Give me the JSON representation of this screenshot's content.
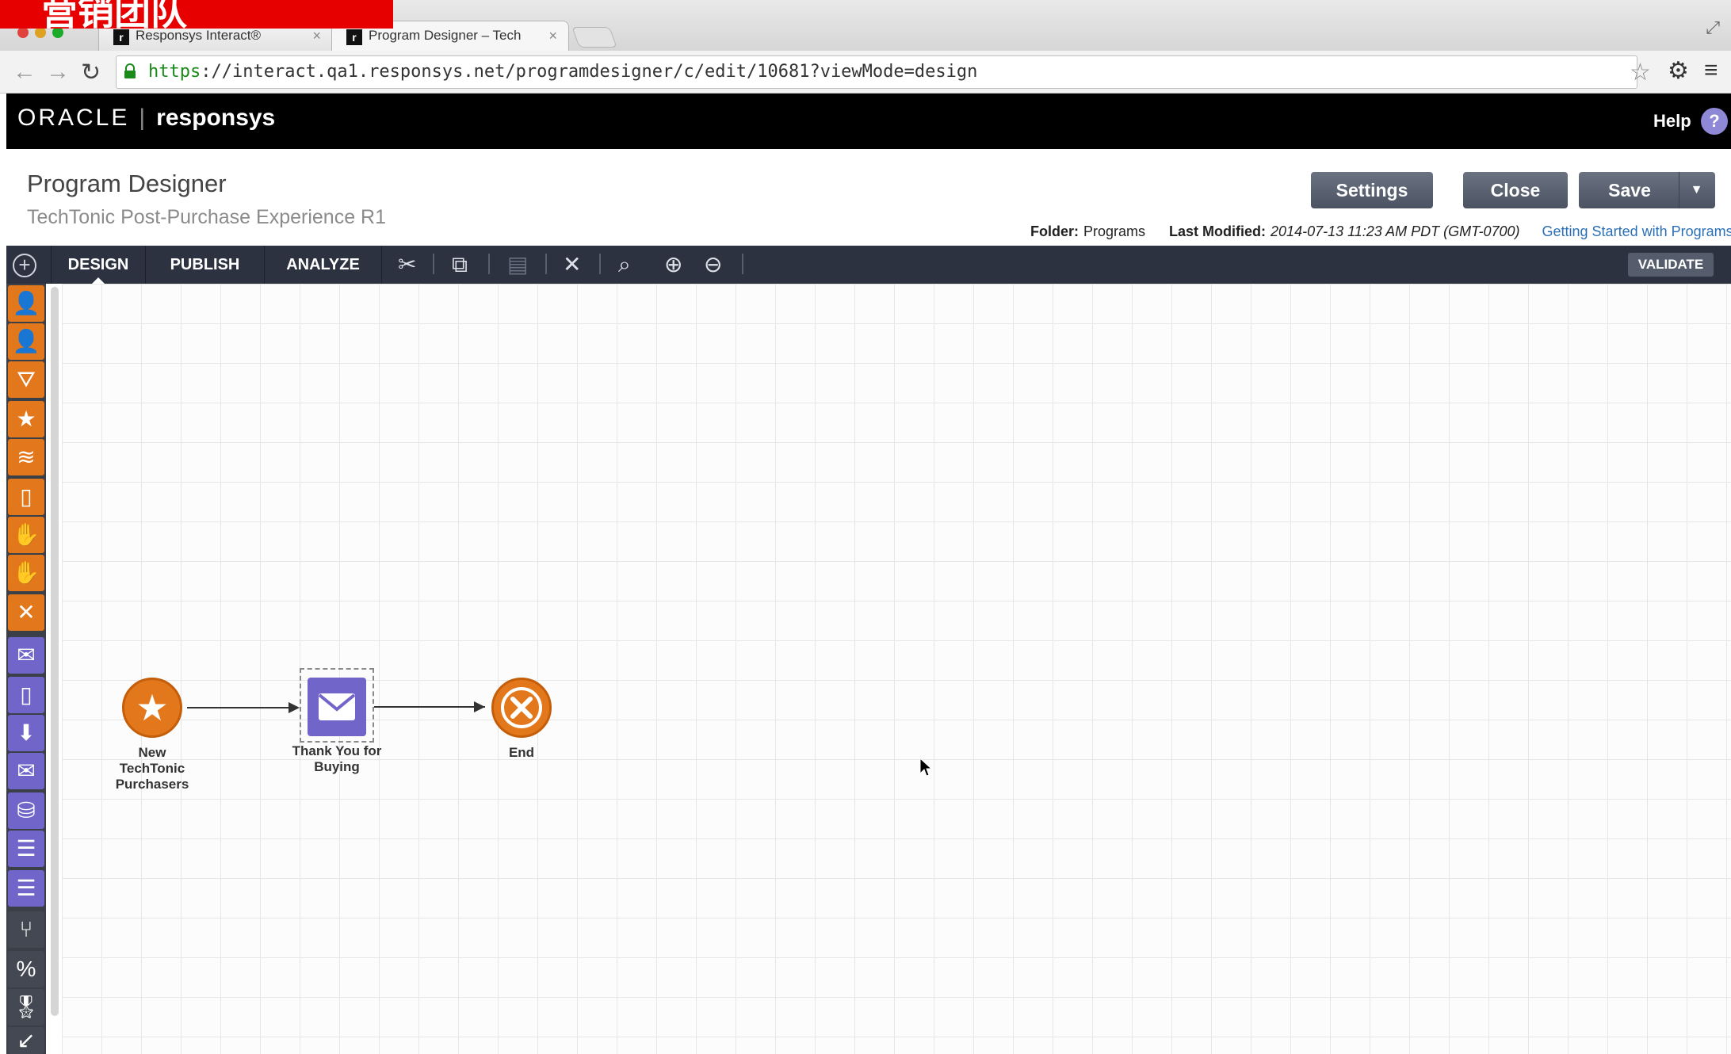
{
  "overlay": {
    "text": "营销团队"
  },
  "browser": {
    "tabs": [
      {
        "label": "Responsys Interact®",
        "favicon": "r"
      },
      {
        "label": "Program Designer – Tech",
        "favicon": "r"
      }
    ],
    "url_scheme": "https",
    "url_rest": "://interact.qa1.responsys.net/programdesigner/c/edit/10681?viewMode=design"
  },
  "app": {
    "logo_oracle": "ORACLE",
    "logo_product": "responsys",
    "help_label": "Help",
    "help_icon": "?"
  },
  "header": {
    "title": "Program Designer",
    "program_name": "TechTonic Post-Purchase Experience R1",
    "buttons": {
      "settings": "Settings",
      "close": "Close",
      "save": "Save"
    },
    "folder_label": "Folder:",
    "folder_value": "Programs",
    "modified_label": "Last Modified:",
    "modified_value": "2014-07-13 11:23 AM PDT (GMT-0700)",
    "help_link": "Getting Started with Programs"
  },
  "toolbar": {
    "tabs": [
      "DESIGN",
      "PUBLISH",
      "ANALYZE"
    ],
    "active_tab": "DESIGN",
    "validate": "VALIDATE",
    "icons": [
      "cut-icon",
      "copy-icon",
      "paste-icon",
      "delete-icon",
      "zoom-fit-icon",
      "zoom-in-icon",
      "zoom-out-icon"
    ]
  },
  "palette": {
    "icons": [
      "person-icon",
      "person-icon",
      "filter-icon",
      "star-icon",
      "signal-icon",
      "mobile-app-icon",
      "hand-icon",
      "hand-icon",
      "close-icon",
      "email-icon",
      "mobile-icon",
      "inbox-icon",
      "sms-icon",
      "database-icon",
      "form-icon",
      "form-icon",
      "split-icon",
      "percent-icon",
      "award-icon",
      "wait-icon"
    ],
    "colors": {
      "orange": "#e2781b",
      "purple": "#7165c9",
      "gray": "#444852"
    }
  },
  "canvas": {
    "nodes": [
      {
        "type": "start",
        "icon": "star-icon",
        "label_lines": [
          "New",
          "TechTonic",
          "Purchasers"
        ]
      },
      {
        "type": "email",
        "icon": "email-icon",
        "label_lines": [
          "Thank You for",
          "Buying"
        ]
      },
      {
        "type": "end",
        "icon": "end-x-icon",
        "label_lines": [
          "End"
        ]
      }
    ]
  }
}
